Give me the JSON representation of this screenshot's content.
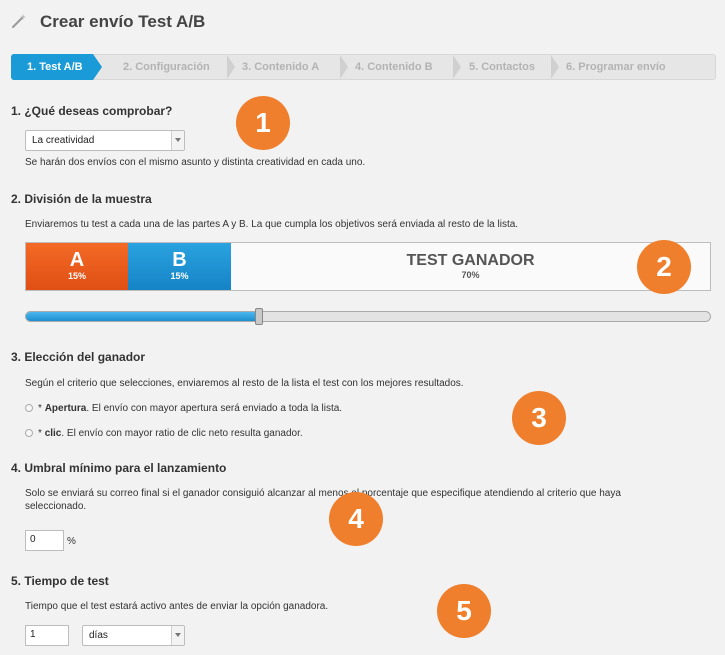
{
  "header": {
    "title": "Crear envío Test A/B"
  },
  "steps": [
    {
      "label": "1. Test A/B"
    },
    {
      "label": "2. Configuración"
    },
    {
      "label": "3. Contenido  A"
    },
    {
      "label": "4. Contenido  B"
    },
    {
      "label": "5. Contactos"
    },
    {
      "label": "6. Programar envío"
    }
  ],
  "section1": {
    "title": "1. ¿Qué deseas comprobar?",
    "select_value": "La creatividad",
    "help": "Se harán dos envíos con el mismo asunto y distinta creatividad en cada uno."
  },
  "section2": {
    "title": "2. División de la muestra",
    "help": "Enviaremos tu test a cada una de las partes A y B. La que cumpla los objetivos será enviada al resto de la lista.",
    "segments": [
      {
        "label": "A",
        "percent": "15%",
        "value": 15
      },
      {
        "label": "B",
        "percent": "15%",
        "value": 15
      },
      {
        "label": "TEST GANADOR",
        "percent": "70%",
        "value": 70
      }
    ],
    "slider_value_percent": 34
  },
  "section3": {
    "title": "3. Elección del ganador",
    "help": "Según el criterio que selecciones, enviaremos al resto de la lista el test con los mejores resultados.",
    "options": [
      {
        "star": "*",
        "name": "Apertura",
        "desc": ". El envío con mayor apertura será enviado a toda la lista."
      },
      {
        "star": "*",
        "name": "clic",
        "desc": ". El envío con mayor ratio de clic neto resulta ganador."
      }
    ]
  },
  "section4": {
    "title": "4. Umbral mínimo para el lanzamiento",
    "help_line1": "Solo se enviará su correo final si el ganador consiguió alcanzar al menos el porcentaje que especifique atendiendo al criterio que haya",
    "help_line2": "seleccionado.",
    "value": "0",
    "unit": "%"
  },
  "section5": {
    "title": "5. Tiempo de test",
    "help": "Tiempo que el test estará activo antes de enviar la opción ganadora.",
    "value": "1",
    "unit_select": "días"
  },
  "badges": [
    "1",
    "2",
    "3",
    "4",
    "5"
  ],
  "colors": {
    "accent": "#1a9bd7",
    "orange": "#ef7f2d",
    "segment_a": "#e8571b",
    "segment_b": "#1a8fd0"
  }
}
